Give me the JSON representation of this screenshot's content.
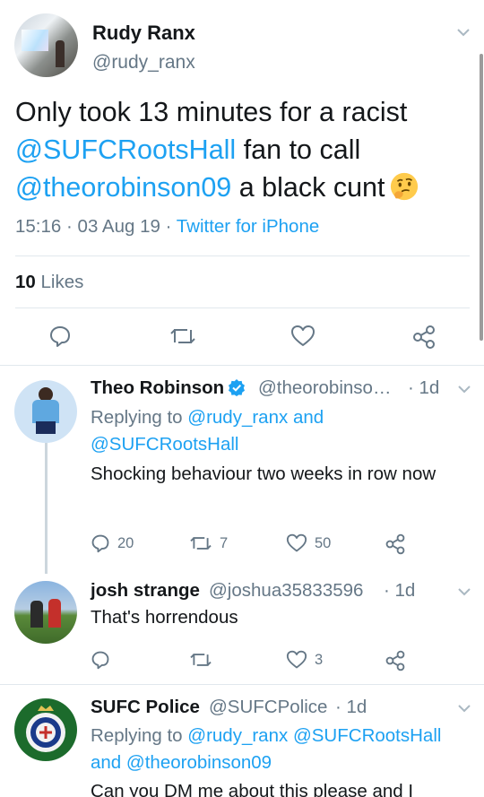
{
  "main_tweet": {
    "author_name": "Rudy Ranx",
    "author_handle": "@rudy_ranx",
    "text_part1": "Only took 13 minutes for a racist ",
    "mention1": "@SUFCRootsHall",
    "text_part2": " fan to call ",
    "mention2": "@theorobinson09",
    "text_part3": " a black cunt",
    "emoji": "thinking-face",
    "time": "15:16",
    "date": "03 Aug 19",
    "source": "Twitter for iPhone",
    "likes_count": "10",
    "likes_label": "Likes"
  },
  "replies": [
    {
      "name": "Theo Robinson",
      "handle": "@theorobinso…",
      "age": "· 1d",
      "replying_label": "Replying to",
      "replying_to_1": "@rudy_ranx",
      "replying_join": "and",
      "replying_to_2": "@SUFCRootsHall",
      "text": "Shocking behaviour two weeks in row now",
      "reply_count": "20",
      "retweet_count": "7",
      "like_count": "50"
    },
    {
      "name": "josh strange",
      "handle": "@joshua35833596",
      "age": "· 1d",
      "text": "That's horrendous",
      "reply_count": "",
      "retweet_count": "",
      "like_count": "3"
    },
    {
      "name": "SUFC Police",
      "handle": "@SUFCPolice",
      "age": "· 1d",
      "replying_label": "Replying to",
      "replying_to_1": "@rudy_ranx",
      "replying_to_2": "@SUFCRootsHall",
      "replying_join": "and",
      "replying_to_3": "@theorobinson09",
      "text_partial": "Can you DM me about this please and I"
    }
  ],
  "colors": {
    "link": "#1da1f2",
    "muted": "#657786",
    "text": "#14171a",
    "divider": "#e1e8ed"
  },
  "icons": [
    "chevron-down-icon",
    "reply-icon",
    "retweet-icon",
    "like-icon",
    "share-icon",
    "verified-icon",
    "thinking-face-emoji"
  ]
}
